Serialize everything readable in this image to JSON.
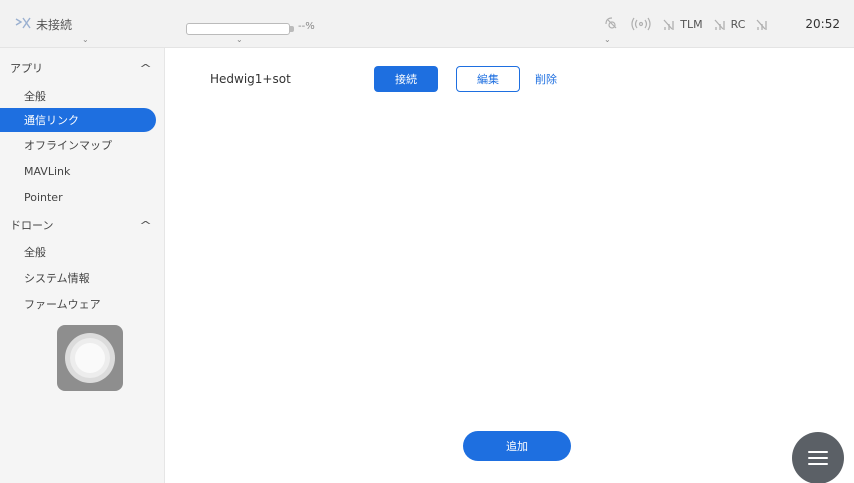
{
  "topbar": {
    "connection_status": "未接続",
    "battery_percent_label": "--%",
    "telemetry_label": "TLM",
    "rc_label": "RC",
    "clock": "20:52"
  },
  "sidebar": {
    "app_section_label": "アプリ",
    "app_items": [
      {
        "label": "全般"
      },
      {
        "label": "通信リンク"
      },
      {
        "label": "オフラインマップ"
      },
      {
        "label": "MAVLink"
      },
      {
        "label": "Pointer"
      }
    ],
    "drone_section_label": "ドローン",
    "drone_items": [
      {
        "label": "全般"
      },
      {
        "label": "システム情報"
      },
      {
        "label": "ファームウェア"
      }
    ],
    "active_item": "通信リンク"
  },
  "main": {
    "links": [
      {
        "name": "Hedwig1+sot",
        "connect_label": "接続",
        "edit_label": "編集",
        "delete_label": "削除"
      }
    ],
    "add_label": "追加"
  },
  "colors": {
    "accent": "#1e6fe0",
    "sidebar_bg": "#f5f5f5",
    "topbar_bg": "#f2f2f2",
    "fab_bg": "#5b6066"
  },
  "icons": [
    "drone-disconnected-icon",
    "gps-icon",
    "signal-broadcast-icon",
    "telemetry-signal-icon",
    "rc-signal-icon",
    "signal-bars-icon",
    "menu-icon"
  ]
}
